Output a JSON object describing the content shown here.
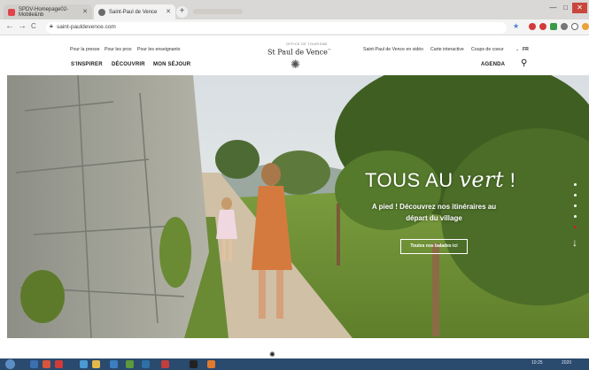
{
  "browser": {
    "tabs": [
      {
        "title": "SPDV-Homepage02-Mobile&nb",
        "favicon_color": "#e2434b"
      },
      {
        "title": "Saint-Paul de Vence",
        "favicon_color": "#6b6b6b"
      }
    ],
    "new_tab": "+",
    "window_buttons": {
      "minimize": "—",
      "maximize": "□",
      "close": "✕"
    },
    "nav": {
      "back": "←",
      "forward": "→",
      "reload": "C"
    },
    "url": "saint-pauldevence.com",
    "bookmark_star": "★"
  },
  "site": {
    "top_links": [
      "Pour la presse",
      "Pour les pros",
      "Pour les enseignants"
    ],
    "right_links": [
      "Saint-Paul de Vence en vidéo",
      "Carte interactive",
      "Coups de coeur"
    ],
    "language": "FR",
    "main_nav": [
      "S'INSPIRER",
      "DÉCOUVRIR",
      "MON SÉJOUR"
    ],
    "agenda": "AGENDA",
    "logo": {
      "small": "OFFICE DE TOURISME",
      "name": "St Paul de Vence",
      "sup": "™"
    }
  },
  "hero": {
    "title_prefix": "TOUS AU ",
    "title_script": "vert",
    "title_suffix": " !",
    "subtitle": "A pied ! Découvrez nos itinéraires au départ du village",
    "cta": "Toutes nos balades ici"
  },
  "taskbar": {
    "time": "10:25",
    "date": "2020"
  },
  "colors": {
    "accent_red": "#c72127",
    "taskbar": "#2a4a6e"
  }
}
